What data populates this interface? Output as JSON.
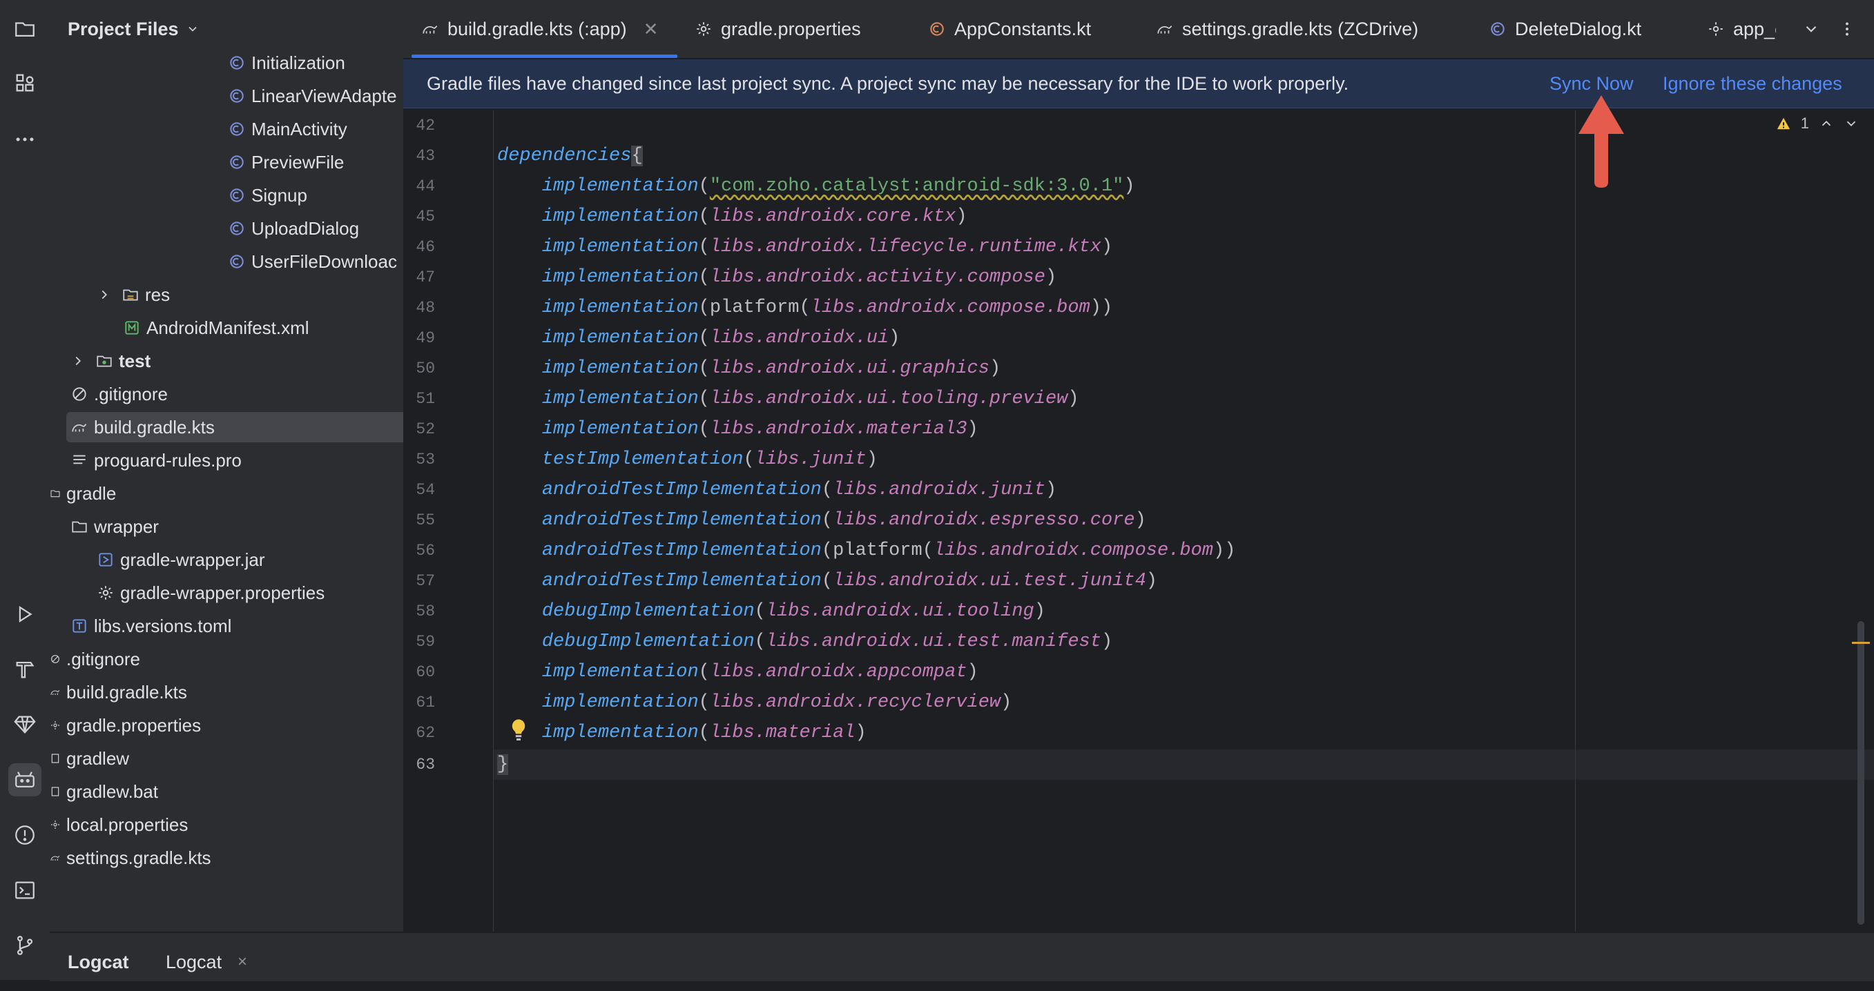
{
  "colors": {
    "accent": "#3574f0",
    "link": "#548af7",
    "banner_bg": "#25324d",
    "arrow": "#e55b4c",
    "keyword": "#56a8f5",
    "reference": "#c77dbb",
    "string": "#6aab73"
  },
  "activity_bar": {
    "top_icons": [
      "folder-icon",
      "structure-icon",
      "more-icon"
    ],
    "bottom_icons": [
      "run-icon",
      "build-icon",
      "gem-icon",
      "android-icon",
      "problems-icon",
      "terminal-icon",
      "git-icon"
    ]
  },
  "project": {
    "title": "Project Files",
    "tree": [
      {
        "label": "Initialization",
        "icon": "kotlin-class-icon"
      },
      {
        "label": "LinearViewAdapte",
        "icon": "kotlin-class-icon"
      },
      {
        "label": "MainActivity",
        "icon": "kotlin-class-icon"
      },
      {
        "label": "PreviewFile",
        "icon": "kotlin-class-icon"
      },
      {
        "label": "Signup",
        "icon": "kotlin-class-icon"
      },
      {
        "label": "UploadDialog",
        "icon": "kotlin-class-icon"
      },
      {
        "label": "UserFileDownloac",
        "icon": "kotlin-class-icon"
      },
      {
        "label": "res",
        "icon": "resource-folder-icon"
      },
      {
        "label": "AndroidManifest.xml",
        "icon": "manifest-icon"
      },
      {
        "label": "test",
        "icon": "test-folder-icon"
      },
      {
        "label": ".gitignore",
        "icon": "ignore-file-icon"
      },
      {
        "label": "build.gradle.kts",
        "icon": "gradle-icon"
      },
      {
        "label": "proguard-rules.pro",
        "icon": "text-file-icon"
      },
      {
        "label": "gradle",
        "icon": "folder-icon"
      },
      {
        "label": "wrapper",
        "icon": "folder-icon"
      },
      {
        "label": "gradle-wrapper.jar",
        "icon": "jar-icon"
      },
      {
        "label": "gradle-wrapper.properties",
        "icon": "settings-file-icon"
      },
      {
        "label": "libs.versions.toml",
        "icon": "toml-icon"
      },
      {
        "label": ".gitignore",
        "icon": "ignore-file-icon"
      },
      {
        "label": "build.gradle.kts",
        "icon": "gradle-icon"
      },
      {
        "label": "gradle.properties",
        "icon": "settings-file-icon"
      },
      {
        "label": "gradlew",
        "icon": "text-file-icon"
      },
      {
        "label": "gradlew.bat",
        "icon": "text-file-icon"
      },
      {
        "label": "local.properties",
        "icon": "settings-file-icon"
      },
      {
        "label": "settings.gradle.kts",
        "icon": "gradle-icon"
      }
    ]
  },
  "tabs": [
    {
      "label": "build.gradle.kts (:app)",
      "icon": "gradle-icon",
      "active": true
    },
    {
      "label": "gradle.properties",
      "icon": "settings-file-icon"
    },
    {
      "label": "AppConstants.kt",
      "icon": "kotlin-class-icon"
    },
    {
      "label": "settings.gradle.kts (ZCDrive)",
      "icon": "gradle-icon"
    },
    {
      "label": "DeleteDialog.kt",
      "icon": "kotlin-class-icon"
    },
    {
      "label": "app_c",
      "icon": "settings-file-icon"
    }
  ],
  "banner": {
    "message": "Gradle files have changed since last project sync. A project sync may be necessary for the IDE to work properly.",
    "sync_now": "Sync Now",
    "ignore": "Ignore these changes"
  },
  "editor": {
    "inspection_count": "1",
    "line_numbers": [
      "42",
      "43",
      "44",
      "45",
      "46",
      "47",
      "48",
      "49",
      "50",
      "51",
      "52",
      "53",
      "54",
      "55",
      "56",
      "57",
      "58",
      "59",
      "60",
      "61",
      "62",
      "63"
    ],
    "deps_keyword": "dependencies",
    "catalyst_artifact": "\"com.zoho.catalyst:android-sdk:3.0.1\"",
    "func": {
      "impl": "implementation",
      "test_impl": "testImplementation",
      "android_test_impl": "androidTestImplementation",
      "debug_impl": "debugImplementation",
      "platform": "platform"
    },
    "refs": {
      "core_ktx": "libs.androidx.core.ktx",
      "lifecycle": "libs.androidx.lifecycle.runtime.ktx",
      "activity": "libs.androidx.activity.compose",
      "compose_bom": "libs.androidx.compose.bom",
      "ui": "libs.androidx.ui",
      "ui_graphics": "libs.androidx.ui.graphics",
      "ui_tooling_preview": "libs.androidx.ui.tooling.preview",
      "material3": "libs.androidx.material3",
      "junit": "libs.junit",
      "androidx_junit": "libs.androidx.junit",
      "espresso": "libs.androidx.espresso.core",
      "ui_test_junit4": "libs.androidx.ui.test.junit4",
      "ui_tooling": "libs.androidx.ui.tooling",
      "ui_test_manifest": "libs.androidx.ui.test.manifest",
      "appcompat": "libs.androidx.appcompat",
      "recyclerview": "libs.androidx.recyclerview",
      "material": "libs.material"
    }
  },
  "bottom": {
    "tab1": "Logcat",
    "tab2": "Logcat",
    "close": "×"
  }
}
